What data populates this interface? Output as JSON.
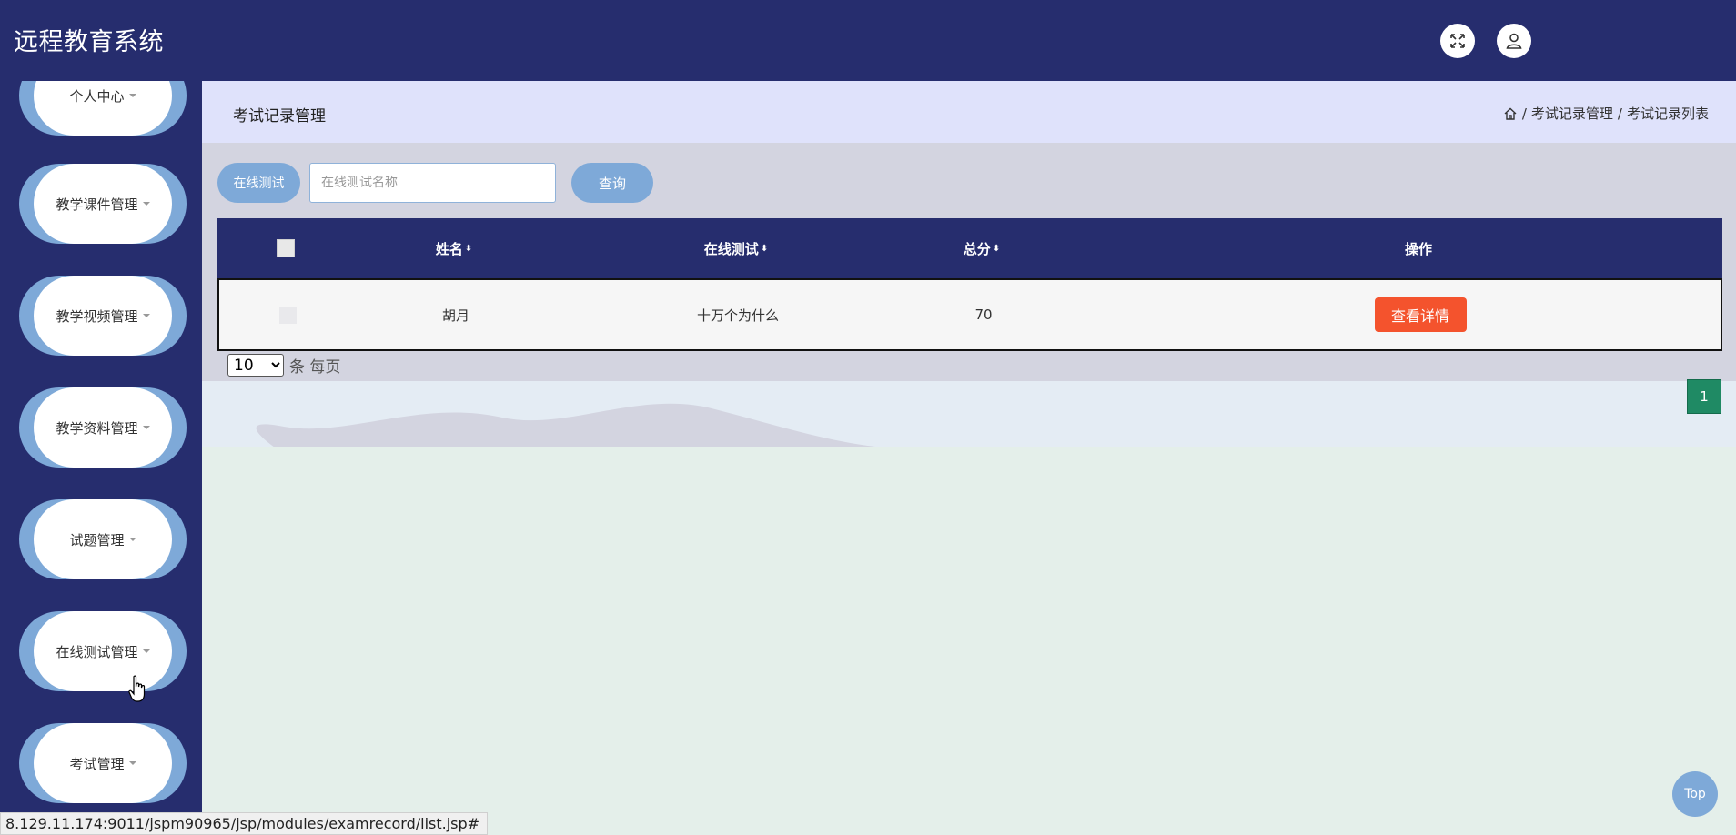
{
  "app": {
    "title": "远程教育系统"
  },
  "header": {
    "icons": [
      "fullscreen-icon",
      "user-icon"
    ]
  },
  "sidebar": {
    "items": [
      {
        "label": "个人中心"
      },
      {
        "label": "教学课件管理"
      },
      {
        "label": "教学视频管理"
      },
      {
        "label": "教学资料管理"
      },
      {
        "label": "试题管理"
      },
      {
        "label": "在线测试管理"
      },
      {
        "label": "考试管理"
      }
    ]
  },
  "page": {
    "title": "考试记录管理",
    "breadcrumb": [
      "考试记录管理",
      "考试记录列表"
    ],
    "breadcrumb_sep": "/"
  },
  "search": {
    "label": "在线测试",
    "placeholder": "在线测试名称",
    "value": "",
    "button": "查询"
  },
  "table": {
    "headers": {
      "name": "姓名",
      "test": "在线测试",
      "score": "总分",
      "action": "操作"
    },
    "sort_glyph": "⬍",
    "rows": [
      {
        "name": "胡月",
        "test": "十万个为什么",
        "score": "70",
        "action": "查看详情"
      }
    ]
  },
  "pagination": {
    "page_size": "10",
    "page_size_options": [
      "10"
    ],
    "per_page_text": "条 每页",
    "current_page": "1"
  },
  "top_button": "Top",
  "status_url": "8.129.11.174:9011/jspm90965/jsp/modules/examrecord/list.jsp#",
  "colors": {
    "primary": "#262d6e",
    "accent": "#7ea9d8",
    "danger": "#f4532d",
    "page_active": "#1f8a64"
  }
}
